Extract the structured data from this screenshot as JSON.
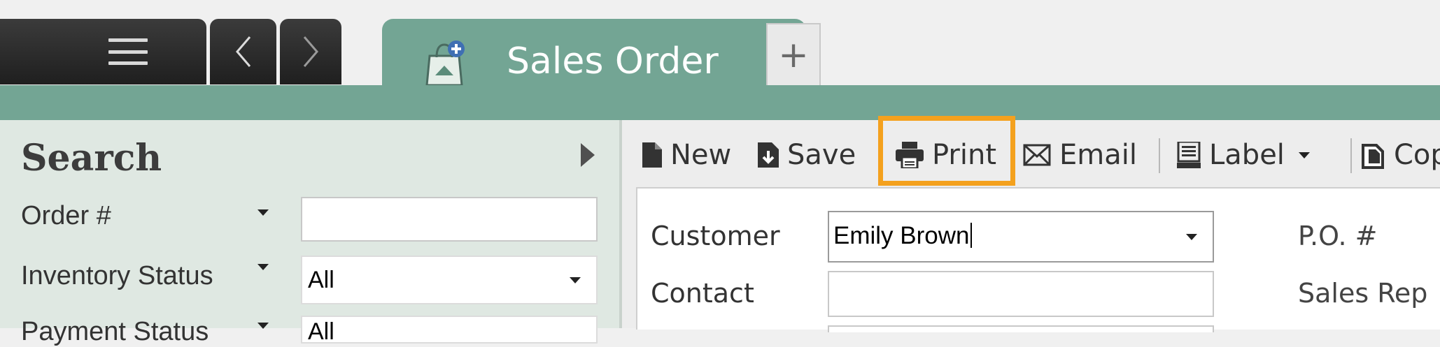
{
  "tab": {
    "title": "Sales Order",
    "new_tab_symbol": "+",
    "icon": "sales-bag-icon"
  },
  "nav": {
    "menu_icon": "hamburger-icon",
    "back_symbol": "<",
    "forward_symbol": ">"
  },
  "search": {
    "title": "Search",
    "filters": [
      {
        "label": "Order #",
        "value": ""
      },
      {
        "label": "Inventory Status",
        "value": "All"
      },
      {
        "label": "Payment Status",
        "value": "All"
      }
    ]
  },
  "toolbar": {
    "items": [
      {
        "label": "New",
        "icon": "new-document-icon"
      },
      {
        "label": "Save",
        "icon": "save-icon"
      },
      {
        "label": "Print",
        "icon": "printer-icon"
      },
      {
        "label": "Email",
        "icon": "email-icon"
      },
      {
        "label": "Label",
        "icon": "label-icon"
      },
      {
        "label": "Copy",
        "icon": "copy-icon"
      }
    ]
  },
  "form": {
    "customer_label": "Customer",
    "customer_value": "Emily Brown",
    "contact_label": "Contact",
    "contact_value": "",
    "po_label": "P.O. #",
    "sales_rep_label": "Sales Rep"
  },
  "colors": {
    "accent_green": "#73a594",
    "highlight_orange": "#f4a11e",
    "nav_dark": "#2a2a2a"
  }
}
